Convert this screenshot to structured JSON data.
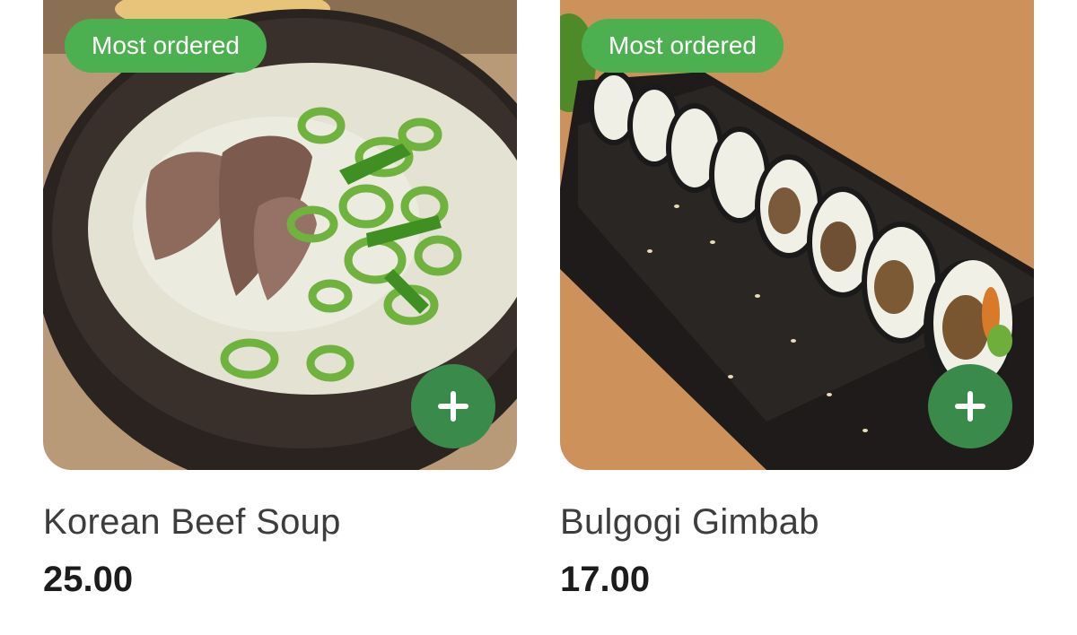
{
  "theme": {
    "accent": "#4caf50",
    "button": "#3a8a4c",
    "text": "#3d3d3d",
    "price_text": "#1c1c1c"
  },
  "products": [
    {
      "name": "Korean Beef Soup",
      "price": "25.00",
      "badge": "Most ordered",
      "add_icon": "plus-icon",
      "image": "korean-beef-soup-photo"
    },
    {
      "name": "Bulgogi Gimbab",
      "price": "17.00",
      "badge": "Most ordered",
      "add_icon": "plus-icon",
      "image": "bulgogi-gimbab-photo"
    }
  ]
}
